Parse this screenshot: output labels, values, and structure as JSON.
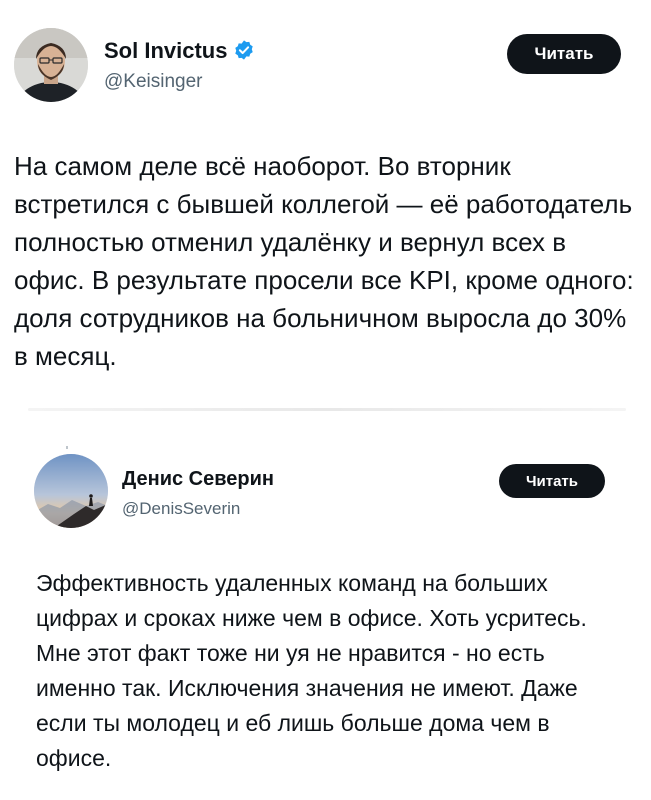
{
  "tweets": [
    {
      "author": {
        "name": "Sol Invictus",
        "handle": "@Keisinger",
        "verified": true,
        "avatar_icon": "man-with-beard-avatar"
      },
      "follow_button": "Читать",
      "text": "На самом деле всё наоборот. Во вторник встретился с бывшей коллегой — её работодатель полностью отменил удалёнку и вернул всех в офис. В результате просели все KPI, кроме одного: доля сотрудников на больничном выросла до 30% в месяц."
    },
    {
      "author": {
        "name": "Денис Северин",
        "handle": "@DenisSeverin",
        "verified": false,
        "avatar_icon": "mountain-silhouette-avatar"
      },
      "follow_button": "Читать",
      "text": "Эффективность удаленных команд на больших цифрах и сроках ниже чем в офисе. Хоть усритесь. Мне этот факт тоже ни уя не нравится - но есть именно так. Исключения значения не имеют. Даже если ты молодец и еб лишь больше дома чем в офисе."
    }
  ],
  "colors": {
    "text_primary": "#0f1419",
    "text_secondary": "#536471",
    "verified_blue": "#1d9bf0",
    "button_bg": "#0f1419",
    "button_text": "#ffffff"
  }
}
